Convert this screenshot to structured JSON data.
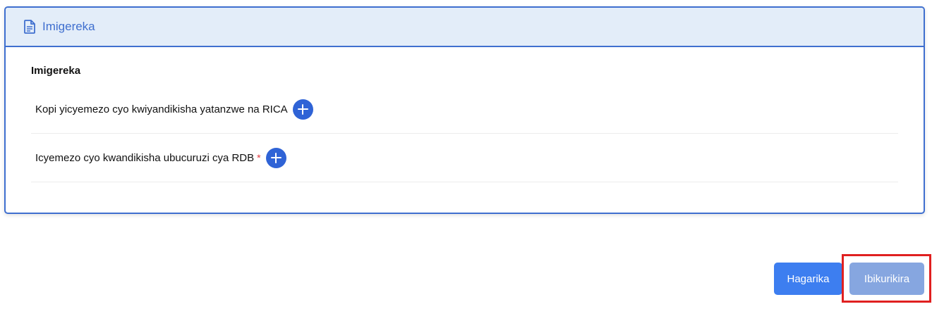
{
  "card": {
    "header_title": "Imigereka",
    "header_icon": "document-icon",
    "section_title": "Imigereka",
    "documents": [
      {
        "label": "Kopi yicyemezo cyo kwiyandikisha yatanzwe na RICA",
        "required": false,
        "add_icon": "plus-circle-icon"
      },
      {
        "label": "Icyemezo cyo kwandikisha ubucuruzi cya RDB",
        "required": true,
        "required_mark": "*",
        "add_icon": "plus-circle-icon"
      }
    ]
  },
  "actions": {
    "cancel_label": "Hagarika",
    "continue_label": "Ibikurikira"
  },
  "colors": {
    "accent": "#3f6fcf",
    "header_bg": "#e3edf9",
    "add_button": "#2f63d6",
    "cancel_button": "#3d7ef0",
    "continue_button": "#86a6e0",
    "required": "#e0383e",
    "highlight": "#e02020"
  }
}
